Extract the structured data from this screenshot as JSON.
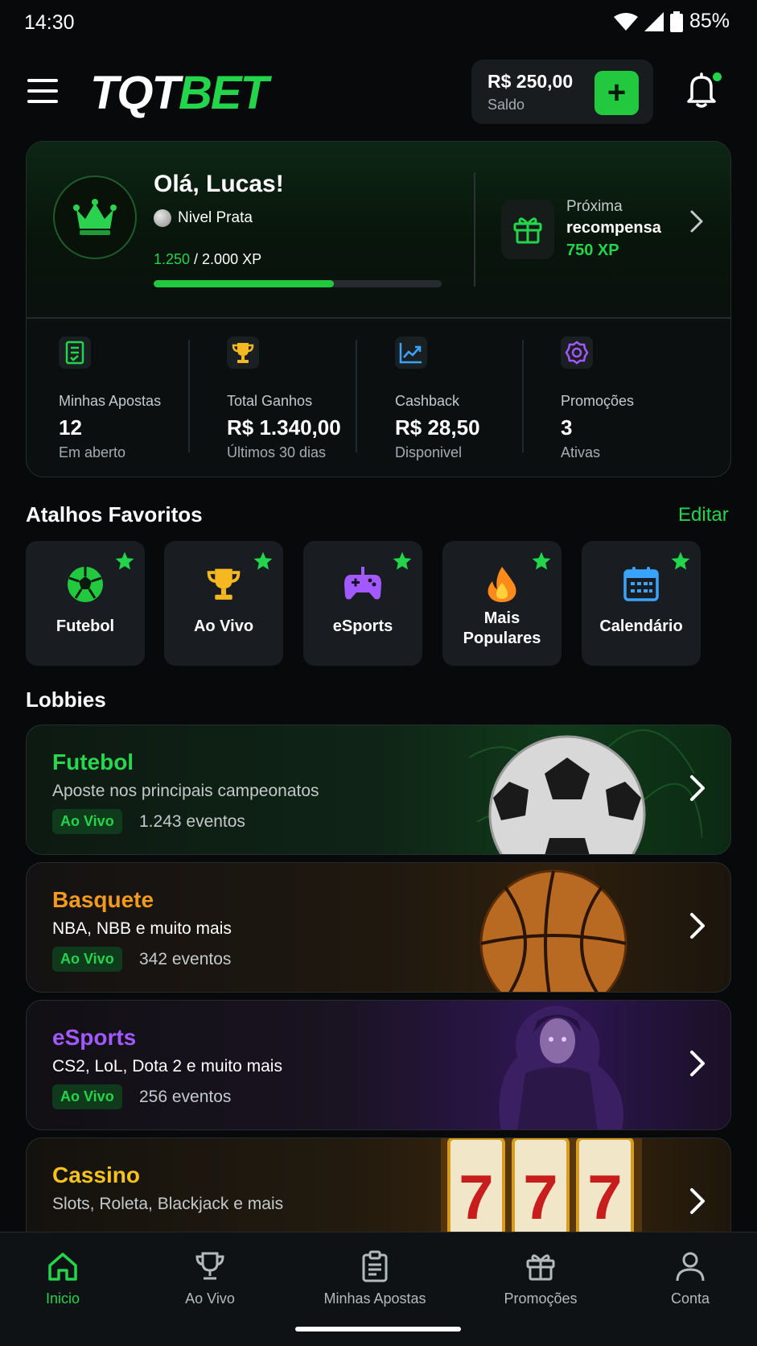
{
  "status_bar": {
    "time": "14:30",
    "battery": "85%"
  },
  "header": {
    "logo_part1": "TQT",
    "logo_part2": "BET",
    "balance_amount": "R$ 250,00",
    "balance_label": "Saldo",
    "add_funds_label": "+"
  },
  "profile": {
    "greeting": "Olá, Lucas!",
    "level": "Nivel Prata",
    "xp_current": "1.250",
    "xp_total": " / 2.000 XP",
    "xp_progress": 0.625,
    "reward_line1": "Próxima",
    "reward_line2": "recompensa",
    "reward_xp": "750 XP"
  },
  "stats": [
    {
      "label": "Minhas Apostas",
      "value": "12",
      "sub": "Em aberto"
    },
    {
      "label": "Total Ganhos",
      "value": "R$ 1.340,00",
      "sub": "Últimos 30 dias"
    },
    {
      "label": "Cashback",
      "value": "R$ 28,50",
      "sub": "Disponivel"
    },
    {
      "label": "Promoções",
      "value": "3",
      "sub": "Ativas"
    }
  ],
  "shortcuts": {
    "title": "Atalhos Favoritos",
    "edit_label": "Editar",
    "items": [
      {
        "label": "Futebol",
        "icon": "soccer-ball-icon"
      },
      {
        "label": "Ao Vivo",
        "icon": "trophy-icon"
      },
      {
        "label": "eSports",
        "icon": "gamepad-icon"
      },
      {
        "label_line1": "Mais",
        "label_line2": "Populares",
        "icon": "fire-icon"
      },
      {
        "label": "Calendário",
        "icon": "calendar-icon"
      }
    ]
  },
  "lobbies": {
    "title": "Lobbies",
    "items": [
      {
        "title": "Futebol",
        "subtitle": "Aposte nos principais campeonatos",
        "badge": "Ao Vivo",
        "count": "1.243 eventos",
        "accent": "#2bd64f"
      },
      {
        "title": "Basquete",
        "subtitle": "NBA, NBB e muito mais",
        "badge": "Ao Vivo",
        "count": "342 eventos",
        "accent": "#f29a1c"
      },
      {
        "title": "eSports",
        "subtitle": "CS2, LoL, Dota 2 e muito mais",
        "badge": "Ao Vivo",
        "count": "256 eventos",
        "accent": "#a259ff"
      },
      {
        "title": "Cassino",
        "subtitle": "Slots, Roleta, Blackjack e mais",
        "accent": "#f7c31b"
      }
    ]
  },
  "bottom_nav": [
    {
      "label": "Inicio",
      "icon": "home-icon",
      "active": true
    },
    {
      "label": "Ao Vivo",
      "icon": "trophy-icon"
    },
    {
      "label": "Minhas Apostas",
      "icon": "clipboard-icon"
    },
    {
      "label": "Promoções",
      "icon": "gift-icon"
    },
    {
      "label": "Conta",
      "icon": "user-icon"
    }
  ],
  "colors": {
    "accent": "#22d54a",
    "background": "#07090a",
    "card": "#191d21"
  }
}
